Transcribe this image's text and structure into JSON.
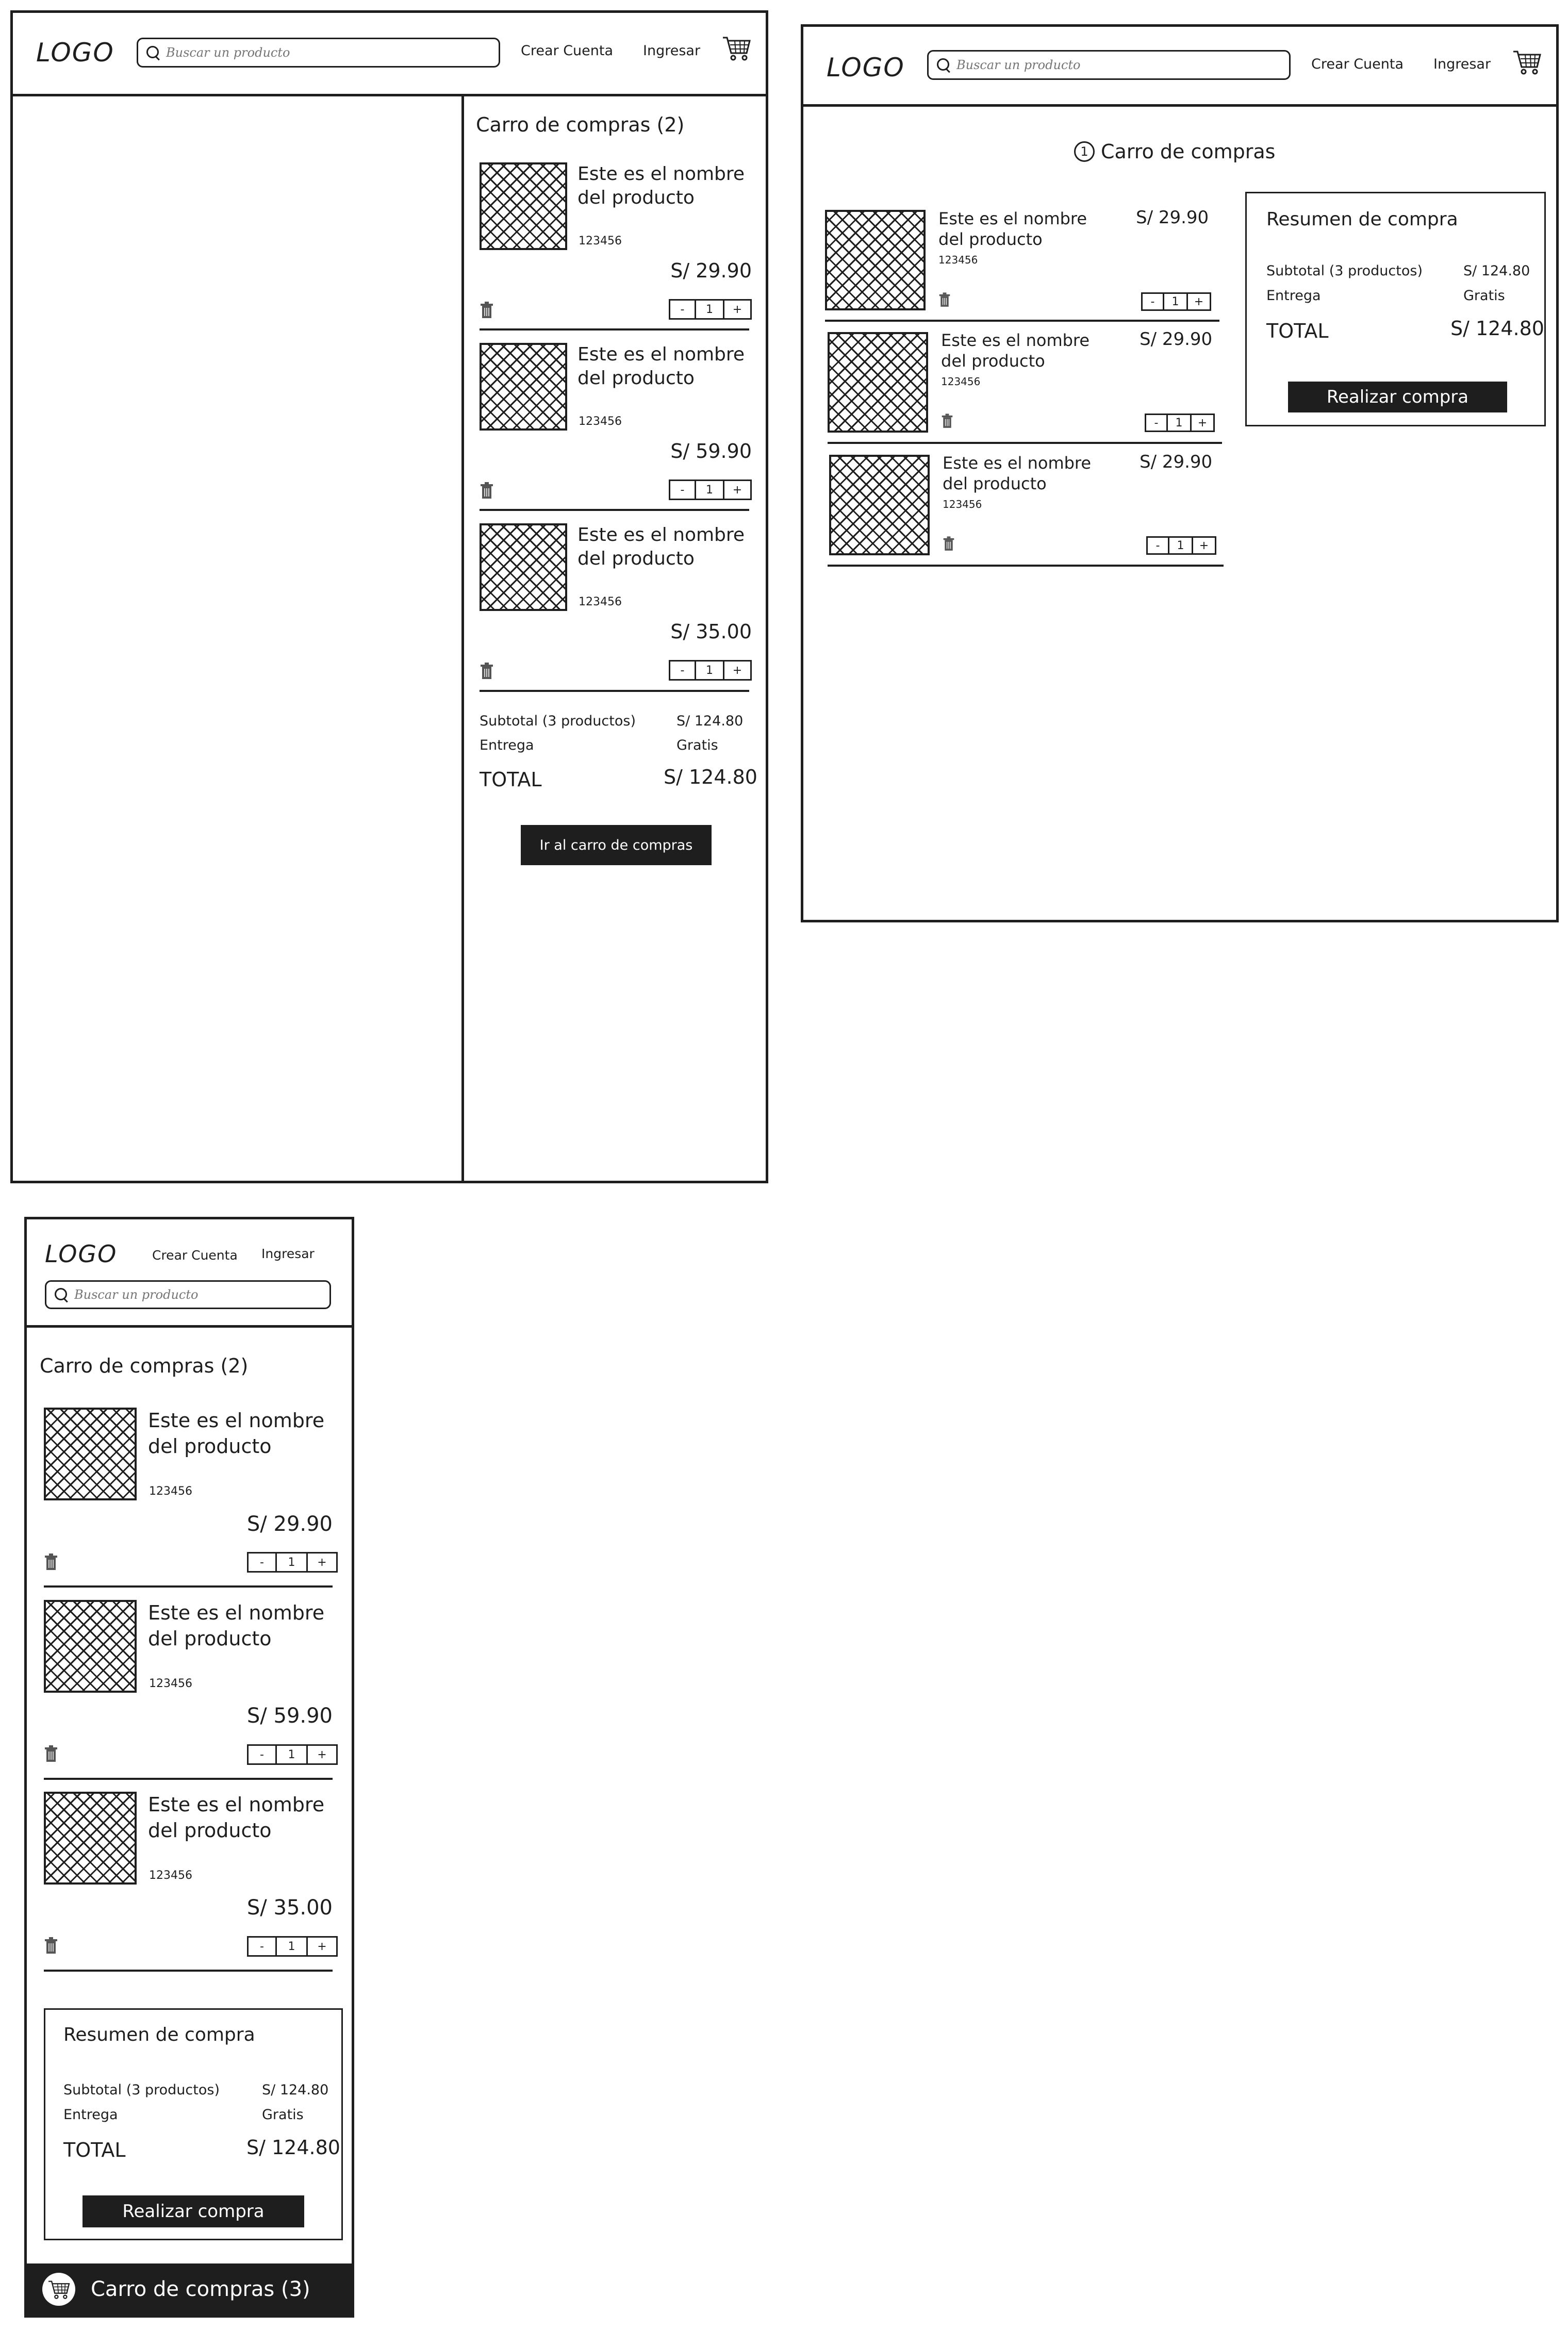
{
  "header": {
    "logo": "LOGO",
    "search_placeholder": "Buscar un producto",
    "create_account": "Crear Cuenta",
    "login": "Ingresar"
  },
  "cart": {
    "title": "Carro de compras (2)",
    "step_number": "1",
    "page_title": "Carro de compras",
    "items": [
      {
        "name": "Este es el nombre del producto",
        "sku": "123456",
        "price": "S/ 29.90",
        "qty": "1"
      },
      {
        "name": "Este es el nombre del producto",
        "sku": "123456",
        "price": "S/ 59.90",
        "qty": "1"
      },
      {
        "name": "Este es el nombre del producto",
        "sku": "123456",
        "price": "S/ 35.00",
        "qty": "1"
      }
    ],
    "page_items": [
      {
        "name": "Este es el nombre del producto",
        "sku": "123456",
        "price": "S/ 29.90",
        "qty": "1"
      },
      {
        "name": "Este es el nombre del producto",
        "sku": "123456",
        "price": "S/ 29.90",
        "qty": "1"
      },
      {
        "name": "Este es el nombre del producto",
        "sku": "123456",
        "price": "S/ 29.90",
        "qty": "1"
      }
    ],
    "minus": "-",
    "plus": "+"
  },
  "summary": {
    "title": "Resumen de compra",
    "subtotal_label": "Subtotal (3 productos)",
    "subtotal_value": "S/ 124.80",
    "delivery_label": "Entrega",
    "delivery_value": "Gratis",
    "total_label": "TOTAL",
    "total_value": "S/ 124.80",
    "go_to_cart": "Ir al carro de compras",
    "checkout": "Realizar compra"
  },
  "mobile_bar": {
    "label": "Carro de compras (3)"
  }
}
